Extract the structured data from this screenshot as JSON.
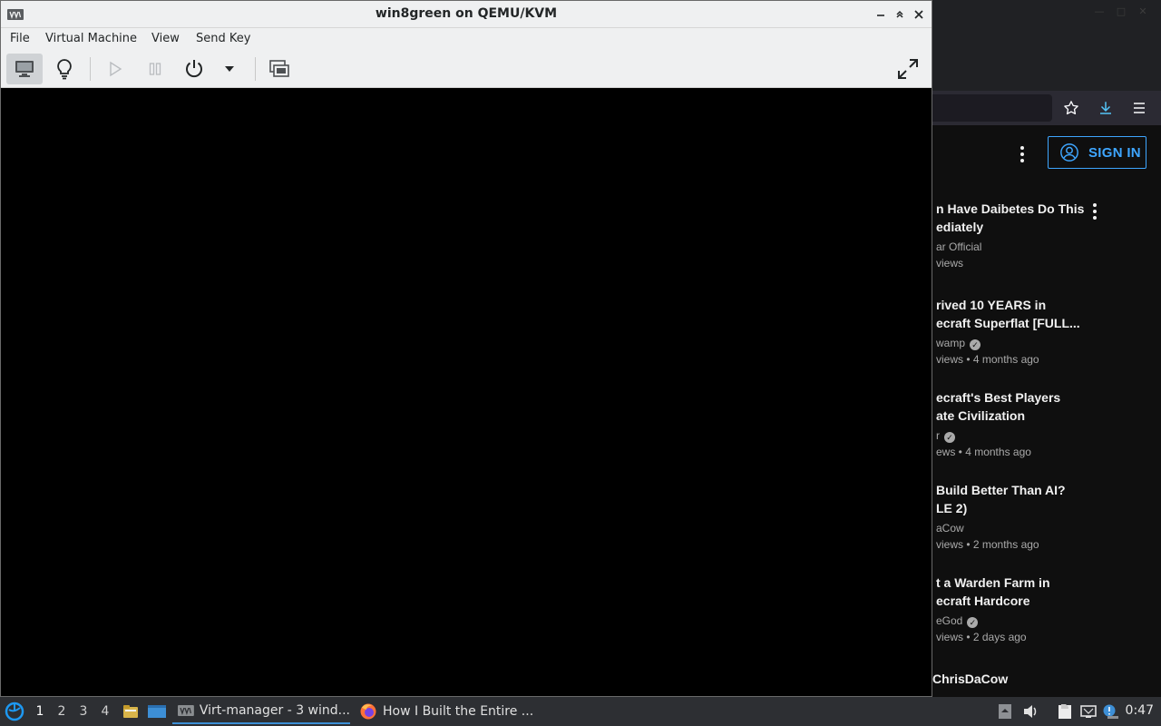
{
  "vm_window": {
    "title": "win8green on QEMU/KVM",
    "menu": [
      "File",
      "Virtual Machine",
      "View",
      "Send Key"
    ]
  },
  "browser": {
    "signin_label": "SIGN IN",
    "recommendations": [
      {
        "title_lines": [
          "n Have Daibetes Do This",
          "ediately"
        ],
        "channel": "ar Official",
        "meta": "views",
        "verified": false
      },
      {
        "title_lines": [
          "rived 10 YEARS in",
          "ecraft Superflat [FULL..."
        ],
        "channel": "wamp",
        "meta": "views • 4 months ago",
        "verified": true
      },
      {
        "title_lines": [
          "ecraft's Best Players",
          "ate Civilization"
        ],
        "channel": "r",
        "meta": "ews • 4 months ago",
        "verified": true
      },
      {
        "title_lines": [
          "Build Better Than AI?",
          "LE 2)"
        ],
        "channel": "aCow",
        "meta": "views • 2 months ago",
        "verified": false
      },
      {
        "title_lines": [
          "t a Warden Farm in",
          "ecraft Hardcore"
        ],
        "channel": "eGod",
        "meta": "views • 2 days ago",
        "verified": true
      },
      {
        "title_lines": [
          "ChrisDaCow"
        ],
        "channel": "",
        "meta": "",
        "verified": false
      }
    ]
  },
  "taskbar": {
    "workspaces": [
      "1",
      "2",
      "3",
      "4"
    ],
    "tasks": [
      {
        "label": "Virt-manager - 3 wind...",
        "icon": "virt-manager-icon"
      },
      {
        "label": "How I Built the Entire ...",
        "icon": "firefox-icon"
      }
    ],
    "clock": "0:47"
  }
}
